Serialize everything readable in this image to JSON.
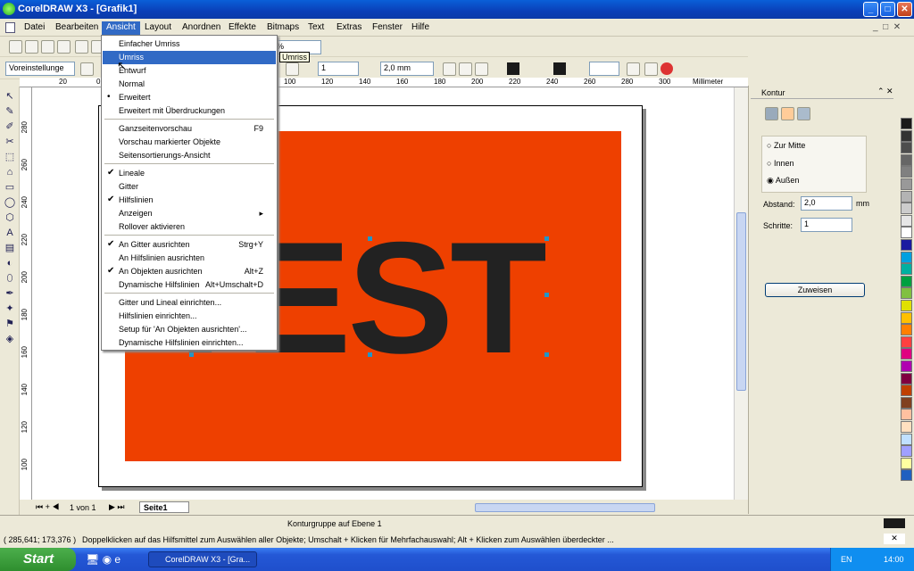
{
  "window": {
    "title": "CorelDRAW X3 - [Grafik1]"
  },
  "menubar": [
    "Datei",
    "Bearbeiten",
    "Ansicht",
    "Layout",
    "Anordnen",
    "Effekte",
    "Bitmaps",
    "Text",
    "Extras",
    "Fenster",
    "Hilfe"
  ],
  "dropdown": {
    "items": [
      {
        "label": "Einfacher Umriss",
        "shortcut": ""
      },
      {
        "label": "Umriss",
        "shortcut": ""
      },
      {
        "label": "Entwurf",
        "shortcut": ""
      },
      {
        "label": "Normal",
        "shortcut": ""
      },
      {
        "label": "Erweitert",
        "shortcut": "",
        "marker": "•"
      },
      {
        "label": "Erweitert mit Überdruckungen",
        "shortcut": ""
      },
      {
        "label": "Ganzseitenvorschau",
        "shortcut": "F9"
      },
      {
        "label": "Vorschau markierter Objekte",
        "shortcut": ""
      },
      {
        "label": "Seitensortierungs-Ansicht",
        "shortcut": ""
      },
      {
        "label": "Lineale",
        "shortcut": "",
        "marker": "✔"
      },
      {
        "label": "Gitter",
        "shortcut": ""
      },
      {
        "label": "Hilfslinien",
        "shortcut": "",
        "marker": "✔"
      },
      {
        "label": "Anzeigen",
        "shortcut": "▸"
      },
      {
        "label": "Rollover aktivieren",
        "shortcut": ""
      },
      {
        "label": "An Gitter ausrichten",
        "shortcut": "Strg+Y",
        "marker": "✔"
      },
      {
        "label": "An Hilfslinien ausrichten",
        "shortcut": ""
      },
      {
        "label": "An Objekten ausrichten",
        "shortcut": "Alt+Z",
        "marker": "✔"
      },
      {
        "label": "Dynamische Hilfslinien",
        "shortcut": "Alt+Umschalt+D"
      },
      {
        "label": "Gitter und Lineal einrichten...",
        "shortcut": ""
      },
      {
        "label": "Hilfslinien einrichten...",
        "shortcut": ""
      },
      {
        "label": "Setup für 'An Objekten ausrichten'...",
        "shortcut": ""
      },
      {
        "label": "Dynamische Hilfslinien einrichten...",
        "shortcut": ""
      }
    ],
    "tooltip": "Umriss"
  },
  "toolbar": {
    "preset": "Voreinstellunge",
    "zoom": "%",
    "steps": "1",
    "outline_width": "2,0 mm"
  },
  "ruler": {
    "unit": "Millimeter",
    "ticks": [
      "20",
      "0",
      "20",
      "40",
      "60",
      "80",
      "100",
      "120",
      "140",
      "160",
      "180",
      "200",
      "220",
      "240",
      "260",
      "280",
      "300",
      "320"
    ],
    "vticks": [
      "280",
      "260",
      "240",
      "220",
      "200",
      "180",
      "160",
      "140",
      "120",
      "100"
    ]
  },
  "canvas": {
    "text": "TEST",
    "fill": "#EE4000"
  },
  "docker": {
    "title": "Kontur",
    "options": [
      "Zur Mitte",
      "Innen",
      "Außen"
    ],
    "selected": "Außen",
    "abstand_label": "Abstand:",
    "abstand_value": "2,0",
    "abstand_unit": "mm",
    "schritte_label": "Schritte:",
    "schritte_value": "1",
    "apply": "Zuweisen"
  },
  "pages": {
    "counter": "1 von 1",
    "tab": "Seite1"
  },
  "status": {
    "layer": "Konturgruppe auf Ebene 1",
    "coords": "( 285,641; 173,376 )",
    "hint": "Doppelklicken auf das Hilfsmittel zum Auswählen aller Objekte; Umschalt + Klicken für Mehrfachauswahl; Alt + Klicken zum Auswählen überdeckter ..."
  },
  "taskbar": {
    "start": "Start",
    "task": "CorelDRAW X3 - [Gra...",
    "lang": "EN",
    "clock": "14:00"
  },
  "palette": [
    "#1a1a1a",
    "#333333",
    "#4d4d4d",
    "#666666",
    "#808080",
    "#999999",
    "#b3b3b3",
    "#cccccc",
    "#e6e6e6",
    "#ffffff",
    "#1a1aa0",
    "#00a0e0",
    "#00b0a0",
    "#00a040",
    "#80c040",
    "#e0e000",
    "#ffc000",
    "#ff8000",
    "#ff4040",
    "#e00080",
    "#b000b0",
    "#800040",
    "#c04000",
    "#804020",
    "#ffc0a0",
    "#ffe0c0",
    "#c0e0ff",
    "#a0a0ff",
    "#ffffa0",
    "#2060c0"
  ]
}
